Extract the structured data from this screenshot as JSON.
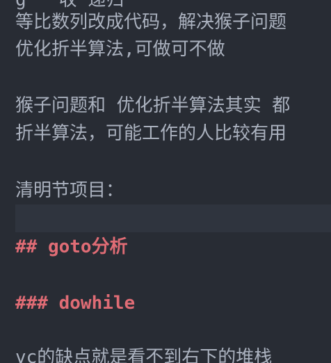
{
  "editor": {
    "lines": [
      "g   收 递归 ",
      "等比数列改成代码，解决猴子问题",
      "优化折半算法,可做可不做",
      "猴子问题和 优化折半算法其实 都",
      "折半算法，可能工作的人比较有用",
      "清明节项目：",
      "## goto分析",
      "### dowhile",
      "vc的缺点就是看不到右下的堆栈"
    ]
  },
  "colors": {
    "background": "#282c34",
    "text": "#abb2bf",
    "heading": "#e06c75",
    "current_line": "#2f343e"
  }
}
